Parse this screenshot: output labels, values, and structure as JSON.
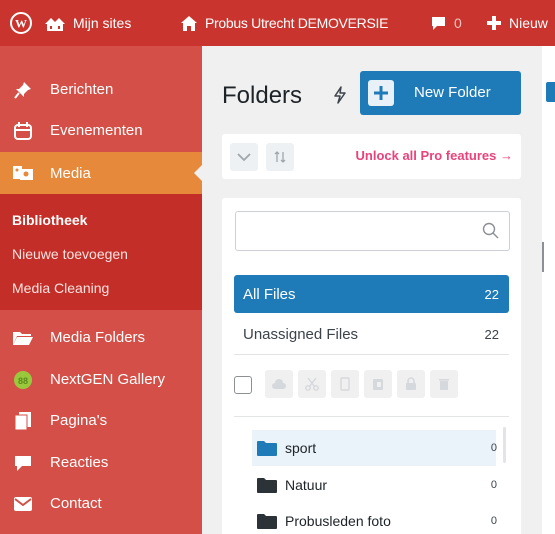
{
  "admin_bar": {
    "my_sites": "Mijn sites",
    "site_name": "Probus Utrecht DEMOVERSIE",
    "comments_count": "0",
    "new_label": "Nieuw"
  },
  "sidebar": {
    "items": [
      {
        "label": "Berichten",
        "icon": "pin-icon"
      },
      {
        "label": "Evenementen",
        "icon": "calendar-icon"
      },
      {
        "label": "Media",
        "icon": "media-icon"
      },
      {
        "label": "Media Folders",
        "icon": "folder-open-icon"
      },
      {
        "label": "NextGEN Gallery",
        "icon": "nextgen-icon"
      },
      {
        "label": "Pagina's",
        "icon": "pages-icon"
      },
      {
        "label": "Reacties",
        "icon": "comment-icon"
      },
      {
        "label": "Contact",
        "icon": "mail-icon"
      }
    ],
    "submenu": [
      {
        "label": "Bibliotheek",
        "current": true
      },
      {
        "label": "Nieuwe toevoegen",
        "current": false
      },
      {
        "label": "Media Cleaning",
        "current": false
      }
    ]
  },
  "folders": {
    "title": "Folders",
    "new_folder_label": "New Folder",
    "unlock_label": "Unlock all Pro features →",
    "search_placeholder": "",
    "all_files_label": "All Files",
    "all_files_count": "22",
    "unassigned_label": "Unassigned Files",
    "unassigned_count": "22",
    "tree": [
      {
        "label": "sport",
        "count": "0",
        "selected": true
      },
      {
        "label": "Natuur",
        "count": "0",
        "selected": false
      },
      {
        "label": "Probusleden foto",
        "count": "0",
        "selected": false
      }
    ]
  },
  "colors": {
    "admin_bar": "#c9352e",
    "sidebar": "#d34f47",
    "active_item": "#e6893b",
    "accent": "#1f7bb7",
    "pro_link": "#e9437a"
  }
}
